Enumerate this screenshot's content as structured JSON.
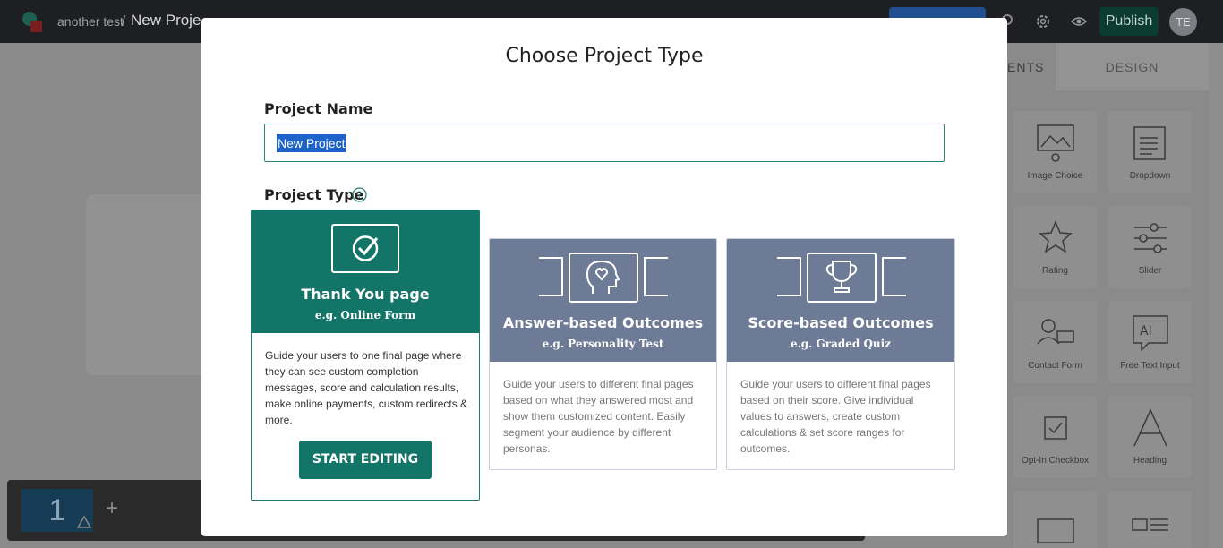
{
  "app": {
    "breadcrumb_parent": "another test",
    "breadcrumb_separator": "/",
    "breadcrumb_current": "New Proje",
    "publish_label": "Publish",
    "avatar_initials": "TE"
  },
  "sidebar": {
    "tab_elements": "ENTS",
    "tab_design": "DESIGN",
    "elements": [
      {
        "label": "Image Choice",
        "icon": "image-choice-icon"
      },
      {
        "label": "Dropdown",
        "icon": "dropdown-icon"
      },
      {
        "label": "Rating",
        "icon": "star-icon"
      },
      {
        "label": "Slider",
        "icon": "slider-icon"
      },
      {
        "label": "Contact Form",
        "icon": "contact-form-icon"
      },
      {
        "label": "Free Text Input",
        "icon": "text-input-icon"
      },
      {
        "label": "Opt-In Checkbox",
        "icon": "checkbox-icon"
      },
      {
        "label": "Heading",
        "icon": "heading-icon"
      }
    ]
  },
  "pages": {
    "current_page": "1"
  },
  "modal": {
    "title": "Choose Project Type",
    "name_label": "Project Name",
    "name_value": "New Project",
    "type_label": "Project Type",
    "types": [
      {
        "name": "Thank You page",
        "example": "e.g. Online Form",
        "description": "Guide your users to one final page where they can see custom completion messages, score and calculation results, make online payments, custom redirects & more.",
        "button": "START EDITING",
        "selected": true
      },
      {
        "name": "Answer-based Outcomes",
        "example": "e.g. Personality Test",
        "description": "Guide your users to different final pages based on what they answered most and show them customized content. Easily segment your audience by different personas.",
        "selected": false
      },
      {
        "name": "Score-based Outcomes",
        "example": "e.g. Graded Quiz",
        "description": "Guide your users to different final pages based on their score. Give individual values to answers, create custom calculations & set score ranges for outcomes.",
        "selected": false
      }
    ]
  },
  "colors": {
    "accent": "#137567",
    "card_header": "#6e7b96",
    "overlay_bg": "#8a8a8a"
  }
}
